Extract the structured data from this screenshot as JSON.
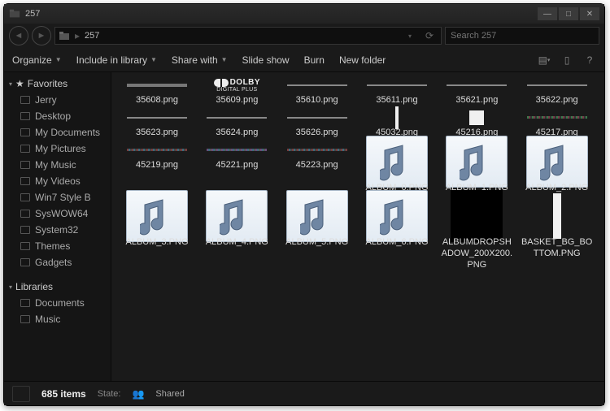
{
  "title": "257",
  "breadcrumb": {
    "path": "257"
  },
  "search": {
    "placeholder": "Search 257"
  },
  "toolbar": {
    "organize": "Organize",
    "include": "Include in library",
    "share": "Share with",
    "slideshow": "Slide show",
    "burn": "Burn",
    "newfolder": "New folder"
  },
  "sidebar": {
    "favorites": "Favorites",
    "items": [
      {
        "label": "Jerry"
      },
      {
        "label": "Desktop"
      },
      {
        "label": "My Documents"
      },
      {
        "label": "My Pictures"
      },
      {
        "label": "My Music"
      },
      {
        "label": "My Videos"
      },
      {
        "label": "Win7 Style B"
      },
      {
        "label": "SysWOW64"
      },
      {
        "label": "System32"
      },
      {
        "label": "Themes"
      },
      {
        "label": "Gadgets"
      }
    ],
    "libraries": "Libraries",
    "libs": [
      {
        "label": "Documents"
      },
      {
        "label": "Music"
      }
    ]
  },
  "files": [
    {
      "name": "35608.png",
      "thumb": "bar-wide"
    },
    {
      "name": "35609.png",
      "thumb": "dolby"
    },
    {
      "name": "35610.png",
      "thumb": "bar-thin"
    },
    {
      "name": "35611.png",
      "thumb": "bar-thin"
    },
    {
      "name": "35621.png",
      "thumb": "bar-thin"
    },
    {
      "name": "35622.png",
      "thumb": "bar-thin"
    },
    {
      "name": "35623.png",
      "thumb": "bar-thin"
    },
    {
      "name": "35624.png",
      "thumb": "bar-thin"
    },
    {
      "name": "35626.png",
      "thumb": "bar-thin"
    },
    {
      "name": "45032.png",
      "thumb": "vlinew"
    },
    {
      "name": "45216.png",
      "thumb": "sqw"
    },
    {
      "name": "45217.png",
      "thumb": "bar-mix"
    },
    {
      "name": "45219.png",
      "thumb": "bar-dot"
    },
    {
      "name": "45221.png",
      "thumb": "bar-dot2"
    },
    {
      "name": "45223.png",
      "thumb": "bar-dot"
    },
    {
      "name": "ALBUM_0.PNG",
      "thumb": "note"
    },
    {
      "name": "ALBUM_1.PNG",
      "thumb": "note"
    },
    {
      "name": "ALBUM_2.PNG",
      "thumb": "note"
    },
    {
      "name": "ALBUM_3.PNG",
      "thumb": "note"
    },
    {
      "name": "ALBUM_4.PNG",
      "thumb": "note"
    },
    {
      "name": "ALBUM_5.PNG",
      "thumb": "note"
    },
    {
      "name": "ALBUM_6.PNG",
      "thumb": "note"
    },
    {
      "name": "ALBUMDROPSHADOW_200X200.PNG",
      "thumb": "sqk"
    },
    {
      "name": "BASKET_BG_BOTTOM.PNG",
      "thumb": "tallw"
    }
  ],
  "status": {
    "count": "685 items",
    "state_label": "State:",
    "state_value": "Shared"
  },
  "dolby": {
    "brand": "DOLBY",
    "sub": "DIGITAL PLUS"
  }
}
